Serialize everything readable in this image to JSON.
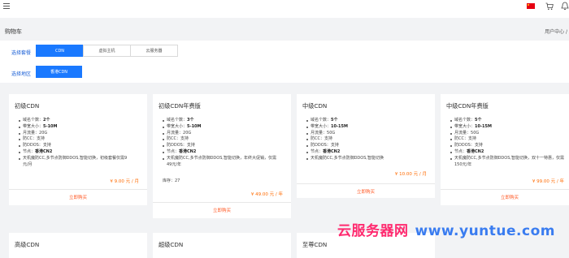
{
  "topbar": {
    "menu_icon": "hamburger-menu-icon",
    "flag_icon": "china-flag-icon",
    "cart_icon": "shopping-cart-icon",
    "bell_icon": "notification-bell-icon"
  },
  "header": {
    "title": "购物车",
    "breadcrumb": "用户中心 /"
  },
  "filters": {
    "package_label": "选择套餐",
    "package_options": [
      "CDN",
      "虚拟主机",
      "云服务器"
    ],
    "package_selected": "CDN",
    "region_label": "选择地区",
    "region_options": [
      "香港CDN"
    ],
    "region_selected": "香港CDN"
  },
  "products": [
    {
      "name": "初级CDN",
      "specs": [
        {
          "label": "域名个数：",
          "value": "2个"
        },
        {
          "label": "带宽大小：",
          "value": "5-10M"
        },
        {
          "label": "月流量：",
          "value": "20G"
        },
        {
          "label": "防CC：",
          "value": "支持"
        },
        {
          "label": "防DDOS：",
          "value": "支持"
        },
        {
          "label": "节点：",
          "value": "香港CN2"
        },
        {
          "label": "",
          "value": "天机魔防CC,多节点防御DDOS,智能切换，初级套餐仅需9元/月"
        }
      ],
      "price": "¥ 9.00 元 / 月",
      "buy_label": "立即购买"
    },
    {
      "name": "初级CDN年费版",
      "specs": [
        {
          "label": "域名个数：",
          "value": "3个"
        },
        {
          "label": "带宽大小：",
          "value": "5-10M"
        },
        {
          "label": "月流量：",
          "value": "20G"
        },
        {
          "label": "防CC：",
          "value": "支持"
        },
        {
          "label": "防DDOS：",
          "value": "支持"
        },
        {
          "label": "节点：",
          "value": "香港CN2"
        },
        {
          "label": "",
          "value": "天机魔防CC,多节点防御DDOS,智能切换，年终大促销，仅需49元/年"
        }
      ],
      "stock": "库存：27",
      "price": "¥ 49.00 元 / 年",
      "buy_label": "立即购买"
    },
    {
      "name": "中级CDN",
      "specs": [
        {
          "label": "域名个数：",
          "value": "5个"
        },
        {
          "label": "带宽大小：",
          "value": "10-15M"
        },
        {
          "label": "月流量：",
          "value": "50G"
        },
        {
          "label": "防CC：",
          "value": "支持"
        },
        {
          "label": "防DDOS：",
          "value": "支持"
        },
        {
          "label": "节点：",
          "value": "香港CN2"
        },
        {
          "label": "",
          "value": "天机魔防CC,多节点防御DDOS,智能切换"
        }
      ],
      "price": "¥ 10.00 元 / 月",
      "buy_label": "立即购买"
    },
    {
      "name": "中级CDN年费版",
      "specs": [
        {
          "label": "域名个数：",
          "value": "5个"
        },
        {
          "label": "带宽大小：",
          "value": "10-15M"
        },
        {
          "label": "月流量：",
          "value": "50G"
        },
        {
          "label": "防CC：",
          "value": "支持"
        },
        {
          "label": "防DDOS：",
          "value": "支持"
        },
        {
          "label": "节点：",
          "value": "香港CN2"
        },
        {
          "label": "",
          "value": "天机魔防CC,多节点防御DDOS,智能切换，双十一特惠，仅需150元/年"
        }
      ],
      "price": "¥ 99.00 元 / 年",
      "buy_label": "立即购买"
    }
  ],
  "more_products": [
    "高级CDN",
    "超级CDN",
    "至尊CDN"
  ],
  "watermark": {
    "cn": "云服务器网",
    "url": "www.yuntue.com"
  }
}
